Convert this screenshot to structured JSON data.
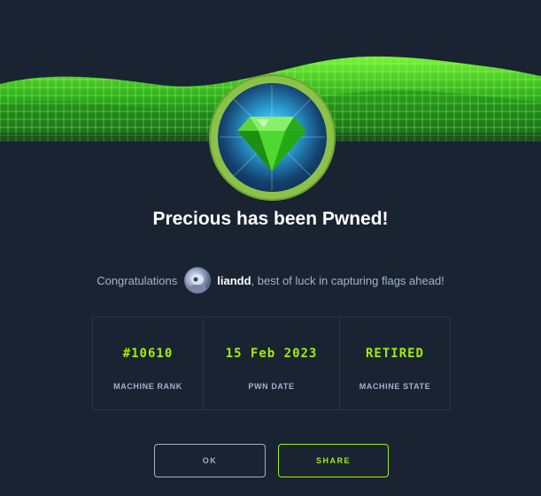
{
  "colors": {
    "background": "#1a2332",
    "accent_green": "#9fef00",
    "muted_text": "#a4b1cd",
    "ring": "#8bc34a"
  },
  "banner": {
    "icon": "green-wave-icon"
  },
  "badge": {
    "icon": "green-gem-icon"
  },
  "heading": {
    "title": "Precious has been Pwned!"
  },
  "message": {
    "prefix": "Congratulations",
    "username": "liandd",
    "suffix": ", best of luck in capturing flags ahead!",
    "avatar_icon": "user-avatar-icon"
  },
  "stats": [
    {
      "value": "#10610",
      "label": "MACHINE RANK"
    },
    {
      "value": "15 Feb 2023",
      "label": "PWN DATE"
    },
    {
      "value": "RETIRED",
      "label": "MACHINE STATE"
    }
  ],
  "buttons": {
    "ok": "OK",
    "share": "SHARE"
  }
}
